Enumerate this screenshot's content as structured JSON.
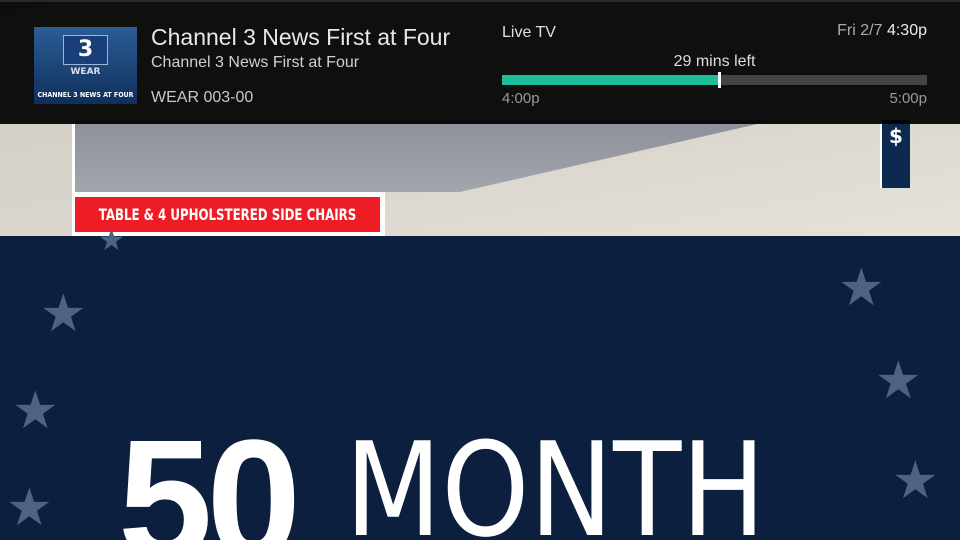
{
  "program": {
    "title": "Channel 3 News First at Four",
    "episode_title": "Channel 3 News First at Four",
    "channel": "WEAR 003-00",
    "logo": {
      "network": "abc",
      "number": "3",
      "callsign": "WEAR",
      "caption": "CHANNEL 3 NEWS AT FOUR"
    }
  },
  "status": {
    "mode": "Live TV",
    "date": "Fri 2/7",
    "time": "4:30p"
  },
  "progress": {
    "remaining_label": "29 mins left",
    "start": "4:00p",
    "end": "5:00p",
    "fraction": 0.51,
    "accent_color": "#1ebd9a"
  },
  "video": {
    "banner": "TABLE & 4 UPHOLSTERED SIDE CHAIRS",
    "side_tag": "$",
    "headline_number": "50",
    "headline_word": "MONTH"
  }
}
